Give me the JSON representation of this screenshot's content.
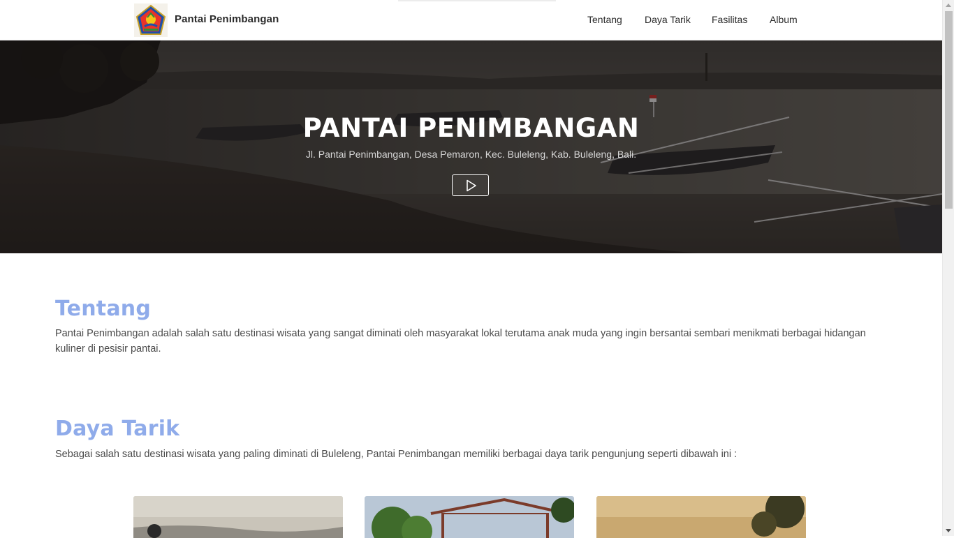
{
  "header": {
    "brand": "Pantai Penimbangan",
    "nav": [
      {
        "label": "Tentang"
      },
      {
        "label": "Daya Tarik"
      },
      {
        "label": "Fasilitas"
      },
      {
        "label": "Album"
      }
    ]
  },
  "hero": {
    "title": "PANTAI PENIMBANGAN",
    "subtitle": "Jl. Pantai Penimbangan, Desa Pemaron, Kec. Buleleng, Kab. Buleleng, Bali."
  },
  "about": {
    "title": "Tentang",
    "text": "Pantai Penimbangan adalah salah satu destinasi wisata yang sangat diminati oleh masyarakat lokal terutama anak muda yang ingin bersantai sembari menikmati berbagai hidangan kuliner di pesisir pantai."
  },
  "attractions": {
    "title": "Daya Tarik",
    "text": "Sebagai salah satu destinasi wisata yang paling diminati di Buleleng, Pantai Penimbangan memiliki berbagai daya tarik pengunjung seperti dibawah ini :"
  },
  "colors": {
    "accent": "#8fabea",
    "nav_text": "#2b2b2b",
    "body_text": "#4a4a4a"
  },
  "icons": {
    "logo": "regency-emblem-icon",
    "play": "play-icon"
  }
}
